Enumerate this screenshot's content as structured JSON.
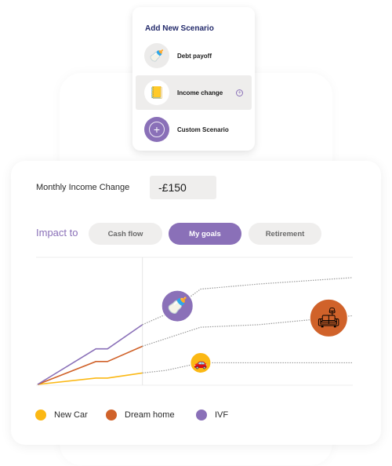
{
  "popup": {
    "title": "Add New Scenario",
    "items": [
      {
        "label": "Debt payoff",
        "icon": "baby-bottle-icon",
        "glyph": "🍼",
        "active": false
      },
      {
        "label": "Income change",
        "icon": "ledger-book-icon",
        "glyph": "📒",
        "active": true
      },
      {
        "label": "Custom Scenario",
        "icon": "plus-circle-icon",
        "glyph": "+",
        "active": false
      }
    ]
  },
  "income": {
    "label": "Monthly Income Change",
    "value": "-£150"
  },
  "impact": {
    "label": "Impact to",
    "tabs": [
      {
        "label": "Cash flow",
        "active": false
      },
      {
        "label": "My goals",
        "active": true
      },
      {
        "label": "Retirement",
        "active": false
      }
    ]
  },
  "colors": {
    "accent": "#8a70b8",
    "new_car": "#fbb814",
    "dream_home": "#d0622a",
    "ivf": "#8a70b8",
    "projection": "#9a9a9a"
  },
  "chart_data": {
    "type": "line",
    "title": "",
    "xlabel": "",
    "ylabel": "",
    "x": [
      0,
      5,
      6,
      9
    ],
    "projection_x": [
      9,
      11,
      14,
      19,
      27
    ],
    "xlim": [
      0,
      27
    ],
    "ylim": [
      0,
      100
    ],
    "grid": false,
    "divider_x": 9,
    "legend_position": "bottom-left",
    "series": [
      {
        "name": "New Car",
        "color": "#fbb814",
        "values": [
          0,
          5,
          5,
          9
        ],
        "projection": [
          9,
          11,
          17,
          17,
          17
        ],
        "goal_icon": "car-icon",
        "goal_glyph": "🚗",
        "goal_x": 14
      },
      {
        "name": "Dream home",
        "color": "#d0622a",
        "values": [
          0,
          18,
          18,
          30
        ],
        "projection": [
          30,
          36,
          45,
          47,
          54
        ],
        "goal_icon": "sofa-lamp-icon",
        "goal_glyph": "🛋",
        "goal_x": 25
      },
      {
        "name": "IVF",
        "color": "#8a70b8",
        "values": [
          0,
          28,
          28,
          47
        ],
        "projection": [
          47,
          55,
          75,
          79,
          84
        ],
        "goal_icon": "baby-bottle-icon",
        "goal_glyph": "🍼",
        "goal_x": 12
      }
    ]
  }
}
